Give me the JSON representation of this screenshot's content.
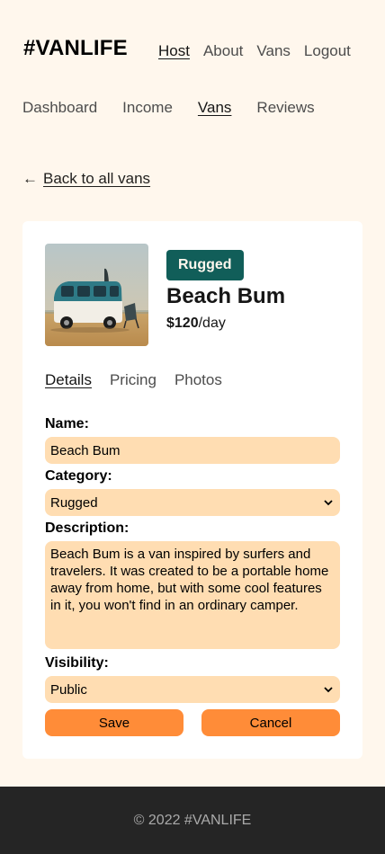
{
  "header": {
    "logo": "#VANLIFE",
    "nav": [
      {
        "label": "Host",
        "active": true
      },
      {
        "label": "About",
        "active": false
      },
      {
        "label": "Vans",
        "active": false
      },
      {
        "label": "Logout",
        "active": false
      }
    ]
  },
  "host_nav": [
    {
      "label": "Dashboard",
      "active": false
    },
    {
      "label": "Income",
      "active": false
    },
    {
      "label": "Vans",
      "active": true
    },
    {
      "label": "Reviews",
      "active": false
    }
  ],
  "back": {
    "arrow": "←",
    "label": "Back to all vans"
  },
  "van": {
    "type_badge": "Rugged",
    "name": "Beach Bum",
    "price": "$120",
    "per": "/day",
    "image_icon": "van-photo-image"
  },
  "tabs": [
    {
      "label": "Details",
      "active": true
    },
    {
      "label": "Pricing",
      "active": false
    },
    {
      "label": "Photos",
      "active": false
    }
  ],
  "form": {
    "name_label": "Name:",
    "name_value": "Beach Bum",
    "category_label": "Category:",
    "category_value": "Rugged",
    "description_label": "Description:",
    "description_value": "Beach Bum is a van inspired by surfers and travelers. It was created to be a portable home away from home, but with some cool features in it, you won't find in an ordinary camper.",
    "visibility_label": "Visibility:",
    "visibility_value": "Public",
    "save_label": "Save",
    "cancel_label": "Cancel"
  },
  "footer": {
    "text": "© 2022 #VANLIFE"
  },
  "colors": {
    "background": "#FFF7ED",
    "badge": "#115E59",
    "field": "#FFDDB2",
    "button": "#FF8C38",
    "footer": "#252525"
  }
}
